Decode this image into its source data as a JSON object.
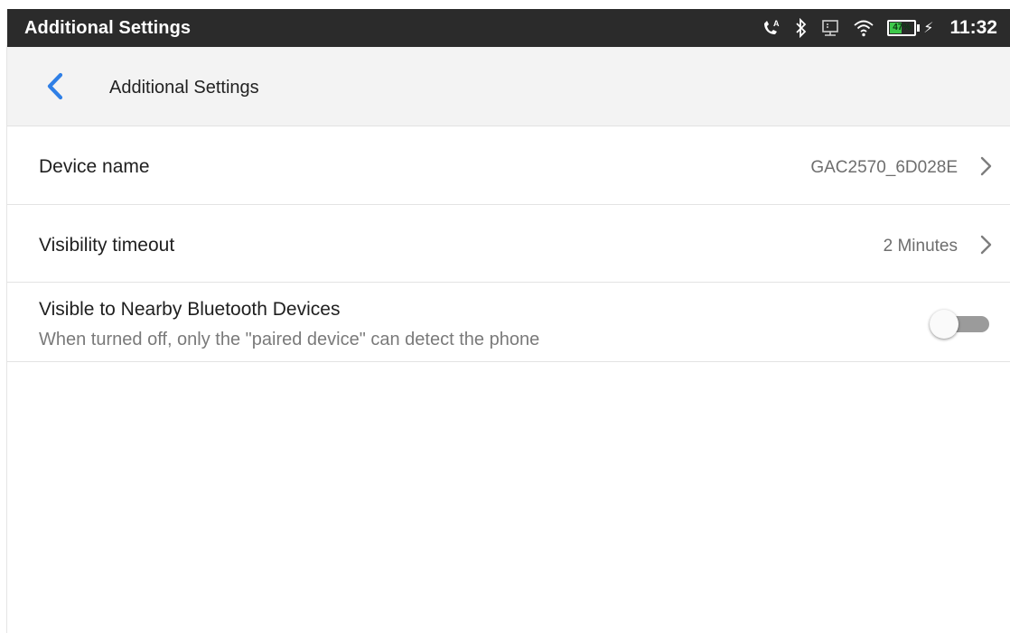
{
  "status_bar": {
    "title": "Additional Settings",
    "time": "11:32",
    "battery_percent": "47%",
    "icons": [
      "call-forward-icon",
      "bluetooth-icon",
      "network-icon",
      "wifi-icon",
      "battery-icon",
      "charging-icon"
    ]
  },
  "app_bar": {
    "title": "Additional Settings",
    "back_icon": "chevron-left-icon",
    "accent": "#2f7fe6"
  },
  "settings": {
    "device_name": {
      "label": "Device name",
      "value": "GAC2570_6D028E"
    },
    "visibility_timeout": {
      "label": "Visibility timeout",
      "value": "2 Minutes"
    },
    "visible_nearby": {
      "label": "Visible to Nearby Bluetooth Devices",
      "description": "When turned off, only the \"paired device\" can detect the phone",
      "enabled": false
    }
  }
}
